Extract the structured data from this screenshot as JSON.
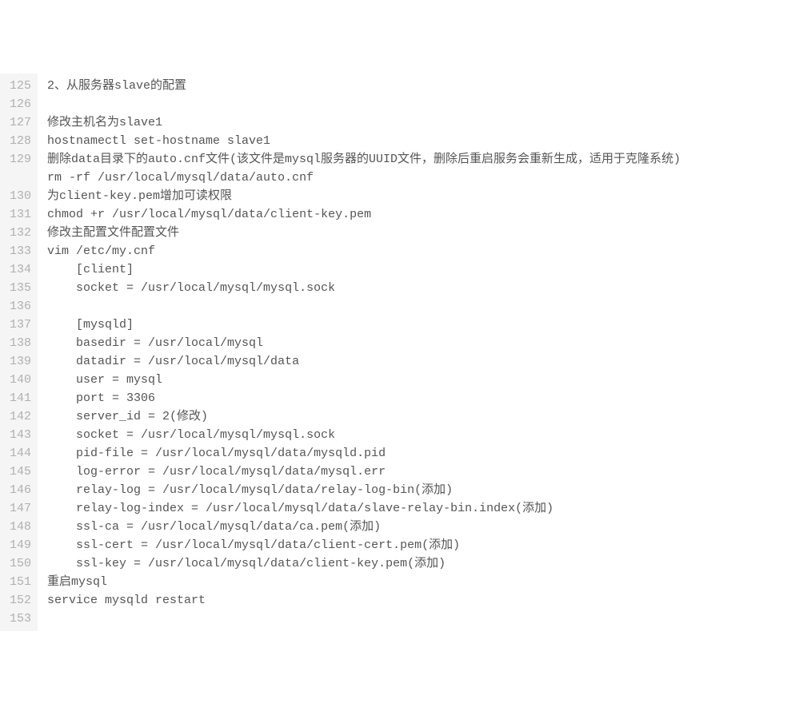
{
  "startLine": 125,
  "lines": [
    {
      "num": "125",
      "text": "2、从服务器slave的配置"
    },
    {
      "num": "126",
      "text": ""
    },
    {
      "num": "127",
      "text": "修改主机名为slave1"
    },
    {
      "num": "128",
      "text": "hostnamectl set-hostname slave1"
    },
    {
      "num": "129",
      "text": "删除data目录下的auto.cnf文件(该文件是mysql服务器的UUID文件，删除后重启服务会重新生成，适用于克隆系统)",
      "wrapped": true
    },
    {
      "num": "130",
      "text": "rm -rf /usr/local/mysql/data/auto.cnf"
    },
    {
      "num": "131",
      "text": "为client-key.pem增加可读权限"
    },
    {
      "num": "132",
      "text": "chmod +r /usr/local/mysql/data/client-key.pem"
    },
    {
      "num": "133",
      "text": "修改主配置文件配置文件"
    },
    {
      "num": "134",
      "text": "vim /etc/my.cnf"
    },
    {
      "num": "135",
      "text": "    [client]"
    },
    {
      "num": "136",
      "text": "    socket = /usr/local/mysql/mysql.sock"
    },
    {
      "num": "137",
      "text": ""
    },
    {
      "num": "138",
      "text": "    [mysqld]"
    },
    {
      "num": "139",
      "text": "    basedir = /usr/local/mysql"
    },
    {
      "num": "140",
      "text": "    datadir = /usr/local/mysql/data"
    },
    {
      "num": "141",
      "text": "    user = mysql"
    },
    {
      "num": "142",
      "text": "    port = 3306"
    },
    {
      "num": "143",
      "text": "    server_id = 2(修改)"
    },
    {
      "num": "144",
      "text": "    socket = /usr/local/mysql/mysql.sock"
    },
    {
      "num": "145",
      "text": "    pid-file = /usr/local/mysql/data/mysqld.pid"
    },
    {
      "num": "146",
      "text": "    log-error = /usr/local/mysql/data/mysql.err"
    },
    {
      "num": "147",
      "text": "    relay-log = /usr/local/mysql/data/relay-log-bin(添加)"
    },
    {
      "num": "148",
      "text": "    relay-log-index = /usr/local/mysql/data/slave-relay-bin.index(添加)"
    },
    {
      "num": "149",
      "text": "    ssl-ca = /usr/local/mysql/data/ca.pem(添加)"
    },
    {
      "num": "150",
      "text": "    ssl-cert = /usr/local/mysql/data/client-cert.pem(添加)"
    },
    {
      "num": "151",
      "text": "    ssl-key = /usr/local/mysql/data/client-key.pem(添加)"
    },
    {
      "num": "152",
      "text": "重启mysql"
    },
    {
      "num": "153",
      "text": "service mysqld restart"
    }
  ]
}
